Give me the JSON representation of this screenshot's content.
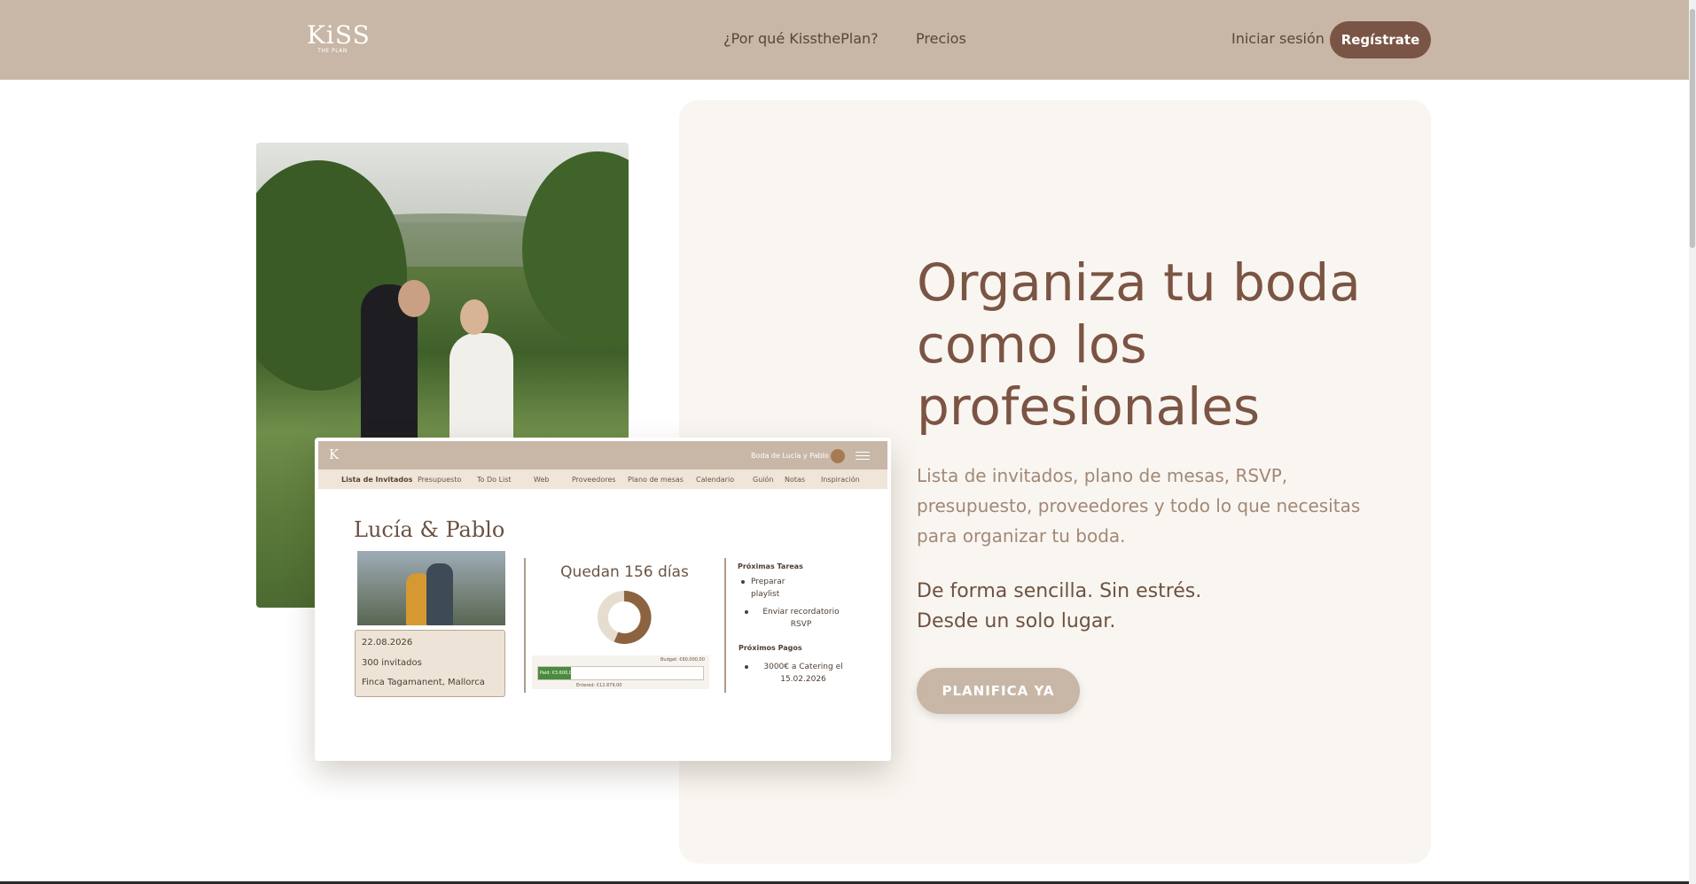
{
  "header": {
    "logo_text": "KiSS",
    "logo_sub": "THE PLAN",
    "nav": {
      "why": "¿Por qué KissthePlan?",
      "prices": "Precios"
    },
    "login": "Iniciar sesión",
    "register": "Regístrate"
  },
  "hero": {
    "title": "Organiza tu boda como los profesionales",
    "subtitle": "Lista de invitados, plano de mesas, RSVP, presupuesto, proveedores y todo lo que necesitas para organizar tu boda.",
    "tag_line_1": "De forma sencilla. Sin estrés.",
    "tag_line_2": "Desde un solo lugar.",
    "cta": "PLANIFICA YA"
  },
  "mockup": {
    "logo_letter": "K",
    "wedding_label": "Boda de Lucía y Pablo",
    "tabs": [
      "Lista de Invitados",
      "Presupuesto",
      "To Do List",
      "Web",
      "Proveedores",
      "Plano de mesas",
      "Calendario",
      "Guión",
      "Notas",
      "Inspiración"
    ],
    "active_tab": "Lista de Invitados",
    "couple": "Lucía & Pablo",
    "date": "22.08.2026",
    "guests": "300 invitados",
    "venue": "Finca Tagamanent, Mallorca",
    "countdown": "Quedan 156 días",
    "budget_label": "Budget: €60.000,00",
    "paid_label": "Paid: €3.600,00",
    "entered_label": "Entered: €12.879,00",
    "paid_fraction": 0.2,
    "next_tasks_title": "Próximas Tareas",
    "next_tasks": [
      "Preparar playlist",
      "Enviar recordatorio RSVP"
    ],
    "next_payments_title": "Próximos Pagos",
    "next_payments": [
      "3000€ a Catering el 15.02.2026"
    ]
  },
  "colors": {
    "header_bg": "#c8b7a6",
    "brand_dark": "#7a5445",
    "panel_bg": "#f9f6f1"
  }
}
